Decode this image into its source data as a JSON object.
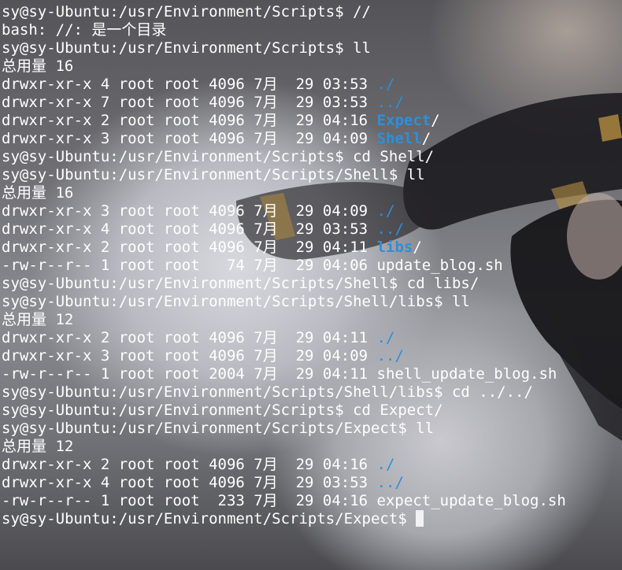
{
  "terminal": {
    "lines": [
      [
        {
          "t": "sy@sy-Ubuntu:/usr/Environment/Scripts$ //"
        }
      ],
      [
        {
          "t": "bash: //: 是一个目录"
        }
      ],
      [
        {
          "t": "sy@sy-Ubuntu:/usr/Environment/Scripts$ ll"
        }
      ],
      [
        {
          "t": "总用量 16"
        }
      ],
      [
        {
          "t": "drwxr-xr-x 4 root root 4096 7月  29 03:53 "
        },
        {
          "t": "./",
          "c": "dir"
        }
      ],
      [
        {
          "t": "drwxr-xr-x 7 root root 4096 7月  29 03:53 "
        },
        {
          "t": "../",
          "c": "dir"
        }
      ],
      [
        {
          "t": "drwxr-xr-x 2 root root 4096 7月  29 04:16 "
        },
        {
          "t": "Expect",
          "c": "dir bold"
        },
        {
          "t": "/"
        }
      ],
      [
        {
          "t": "drwxr-xr-x 3 root root 4096 7月  29 04:09 "
        },
        {
          "t": "Shell",
          "c": "dir bold"
        },
        {
          "t": "/"
        }
      ],
      [
        {
          "t": "sy@sy-Ubuntu:/usr/Environment/Scripts$ cd Shell/"
        }
      ],
      [
        {
          "t": "sy@sy-Ubuntu:/usr/Environment/Scripts/Shell$ ll"
        }
      ],
      [
        {
          "t": "总用量 16"
        }
      ],
      [
        {
          "t": "drwxr-xr-x 3 root root 4096 7月  29 04:09 "
        },
        {
          "t": "./",
          "c": "dir"
        }
      ],
      [
        {
          "t": "drwxr-xr-x 4 root root 4096 7月  29 03:53 "
        },
        {
          "t": "../",
          "c": "dir"
        }
      ],
      [
        {
          "t": "drwxr-xr-x 2 root root 4096 7月  29 04:11 "
        },
        {
          "t": "libs",
          "c": "dir bold"
        },
        {
          "t": "/"
        }
      ],
      [
        {
          "t": "-rw-r--r-- 1 root root   74 7月  29 04:06 update_blog.sh"
        }
      ],
      [
        {
          "t": "sy@sy-Ubuntu:/usr/Environment/Scripts/Shell$ cd libs/"
        }
      ],
      [
        {
          "t": "sy@sy-Ubuntu:/usr/Environment/Scripts/Shell/libs$ ll"
        }
      ],
      [
        {
          "t": "总用量 12"
        }
      ],
      [
        {
          "t": "drwxr-xr-x 2 root root 4096 7月  29 04:11 "
        },
        {
          "t": "./",
          "c": "dir"
        }
      ],
      [
        {
          "t": "drwxr-xr-x 3 root root 4096 7月  29 04:09 "
        },
        {
          "t": "../",
          "c": "dir"
        }
      ],
      [
        {
          "t": "-rw-r--r-- 1 root root 2004 7月  29 04:11 shell_update_blog.sh"
        }
      ],
      [
        {
          "t": "sy@sy-Ubuntu:/usr/Environment/Scripts/Shell/libs$ cd ../../"
        }
      ],
      [
        {
          "t": "sy@sy-Ubuntu:/usr/Environment/Scripts$ cd Expect/"
        }
      ],
      [
        {
          "t": "sy@sy-Ubuntu:/usr/Environment/Scripts/Expect$ ll"
        }
      ],
      [
        {
          "t": "总用量 12"
        }
      ],
      [
        {
          "t": "drwxr-xr-x 2 root root 4096 7月  29 04:16 "
        },
        {
          "t": "./",
          "c": "dir"
        }
      ],
      [
        {
          "t": "drwxr-xr-x 4 root root 4096 7月  29 03:53 "
        },
        {
          "t": "../",
          "c": "dir"
        }
      ],
      [
        {
          "t": "-rw-r--r-- 1 root root  233 7月  29 04:16 expect_update_blog.sh"
        }
      ]
    ],
    "prompt": "sy@sy-Ubuntu:/usr/Environment/Scripts/Expect$ "
  },
  "colors": {
    "text": "#ffffff",
    "directory": "#2f8fd8",
    "cursor": "#f2f2f2"
  }
}
